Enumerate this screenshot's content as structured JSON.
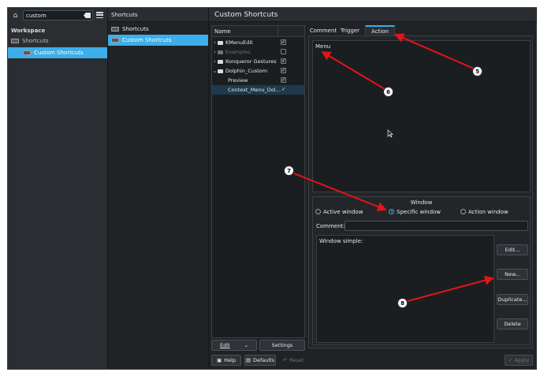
{
  "search": {
    "value": "custom"
  },
  "sidebar": {
    "section": "Workspace",
    "items": [
      {
        "label": "Shortcuts"
      },
      {
        "label": "Custom Shortcuts"
      }
    ]
  },
  "midcol": {
    "header": "Shortcuts",
    "items": [
      {
        "label": "Shortcuts"
      },
      {
        "label": "Custom Shortcuts"
      }
    ]
  },
  "main": {
    "title": "Custom Shortcuts"
  },
  "tree": {
    "header": "Name",
    "rows": [
      {
        "label": "KMenuEdit"
      },
      {
        "label": "Examples"
      },
      {
        "label": "Konqueror Gestures"
      },
      {
        "label": "Dolphin_Custom"
      },
      {
        "label": "Preview"
      },
      {
        "label": "Context_Menu_Dol..."
      }
    ],
    "edit_label": "Edit",
    "settings_label": "Settings"
  },
  "tabs": {
    "comment": "Comment",
    "trigger": "Trigger",
    "action": "Action"
  },
  "action": {
    "menu_label": "Menu",
    "window_group": "Window",
    "radio_active": "Active window",
    "radio_specific": "Specific window",
    "radio_action": "Action window",
    "comment_label": "Comment:",
    "comment_value": "",
    "window_simple": "Window simple:",
    "edit_button": "Edit...",
    "new_button": "New...",
    "duplicate_button": "Duplicate...",
    "delete_button": "Delete"
  },
  "footer": {
    "help": "Help",
    "defaults": "Defaults",
    "reset": "Reset",
    "apply": "Apply"
  },
  "callouts": [
    "5",
    "6",
    "7",
    "8"
  ],
  "colors": {
    "accent": "#3daee9",
    "annotation": "#e3141b"
  }
}
